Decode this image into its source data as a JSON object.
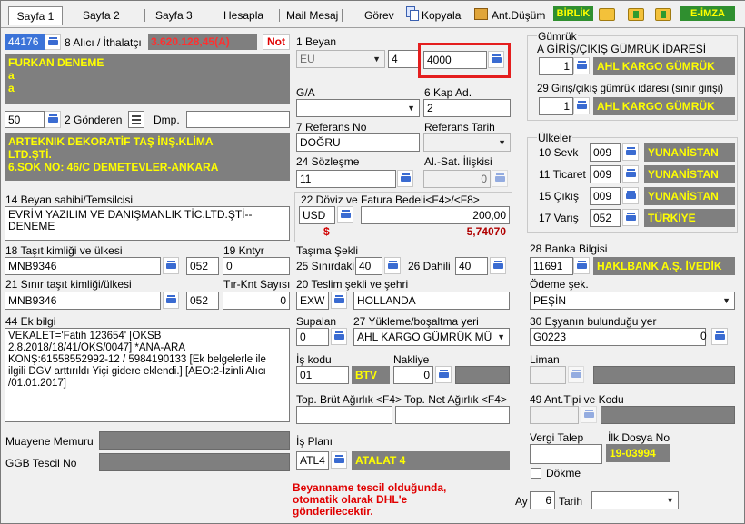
{
  "tabs": [
    "Sayfa 1",
    "Sayfa 2",
    "Sayfa 3",
    "Hesapla",
    "Mail Mesaj",
    "Görev",
    "Kopyala",
    "Ant.Düşüm"
  ],
  "toolbar": {
    "birlik": "BİRLİK",
    "eimza": "E-İMZA"
  },
  "top": {
    "id": "44176",
    "alici_label": "8 Alıcı / İthalatçı",
    "amount": "3.620.128,45(A)",
    "not": "Not"
  },
  "alici": {
    "lines": [
      "FURKAN DENEME",
      "a",
      "a"
    ]
  },
  "gonderen": {
    "num": "50",
    "label": "2 Gönderen",
    "dmp": "Dmp.",
    "lines": [
      "ARTEKNIK DEKORATİF TAŞ İNŞ.KLİMA",
      "LTD.ŞTİ.",
      "6.SOK NO: 46/C DEMETEVLER-ANKARA"
    ]
  },
  "beyan": {
    "label": "1 Beyan",
    "c1": "EU",
    "c2": "4",
    "c3": "4000"
  },
  "ga": {
    "label": "G/A",
    "value": ""
  },
  "kap": {
    "label": "6 Kap Ad.",
    "value": "2"
  },
  "ref": {
    "label": "7 Referans No",
    "value": "DOĞRU",
    "tarih_label": "Referans Tarih"
  },
  "soz": {
    "label": "24 Sözleşme",
    "value": "11",
    "al_label": "Al.-Sat. İlişkisi",
    "al_value": "0"
  },
  "doviz": {
    "label": "22 Döviz ve Fatura Bedeli<F4>/<F8>",
    "cur": "USD",
    "amount": "200,00",
    "dollar": "$",
    "rate": "5,74070"
  },
  "beyan_sahibi": {
    "label": "14 Beyan sahibi/Temsilcisi",
    "lines": [
      "EVRİM YAZILIM VE DANIŞMANLIK TİC.LTD.ŞTİ--",
      "DENEME"
    ]
  },
  "tasit": {
    "label": "18 Taşıt kimliği ve ülkesi",
    "value": "MNB9346",
    "code": "052",
    "kntyr_label": "19 Kntyr",
    "kntyr": "0"
  },
  "sinir": {
    "label": "21 Sınır taşıt kimliği/ülkesi",
    "value": "MNB9346",
    "code": "052",
    "tir_label": "Tır-Knt Sayısı",
    "tir": "0"
  },
  "tasima": {
    "label": "Taşıma Şekli",
    "l25": "25 Sınırdaki",
    "v25": "40",
    "l26": "26 Dahili",
    "v26": "40"
  },
  "teslim": {
    "label": "20 Teslim şekli ve şehri",
    "code": "EXW",
    "city": "HOLLANDA"
  },
  "ek": {
    "label": "44 Ek bilgi",
    "lines": [
      "VEKALET='Fatih 123654' [OKSB",
      "2.8.2018/18/41/OKS/0047] *ANA-ARA",
      "KONŞ:61558552992-12 / 5984190133 [Ek belgelerle ile",
      "ilgili DGV arttırıldı Yiçi gidere eklendi.] [AEO:2-İzinli Alıcı",
      "/01.01.2017]"
    ]
  },
  "supalan": {
    "label": "Supalan",
    "value": "0"
  },
  "yukleme": {
    "label": "27 Yükleme/boşaltma yeri",
    "value": "AHL KARGO GÜMRÜK MÜ"
  },
  "iskodu": {
    "label": "İş kodu",
    "value": "01",
    "btv": "BTV",
    "nak_label": "Nakliye",
    "nak": "0"
  },
  "agirlik": {
    "label": "Top. Brüt Ağırlık <F4> Top. Net Ağırlık <F4>"
  },
  "isplani": {
    "label": "İş Planı",
    "value": "ATL4",
    "name": "ATALAT 4"
  },
  "muayene": {
    "label": "Muayene Memuru"
  },
  "ggb": {
    "label": "GGB Tescil No"
  },
  "red": {
    "lines": [
      "Beyanname tescil olduğunda,",
      "otomatik olarak DHL'e",
      "gönderilecektir."
    ]
  },
  "gumruk": {
    "group": "Gümrük",
    "label1": "A GİRİŞ/ÇIKIŞ GÜMRÜK İDARESİ",
    "v1": "1",
    "n1": "AHL KARGO GÜMRÜK",
    "label2": "29 Giriş/çıkış gümrük idaresi (sınır girişi)",
    "v2": "1",
    "n2": "AHL KARGO GÜMRÜK"
  },
  "ulkeler": {
    "group": "Ülkeler",
    "rows": [
      {
        "label": "10 Sevk",
        "code": "009",
        "name": "YUNANİSTAN"
      },
      {
        "label": "11 Ticaret",
        "code": "009",
        "name": "YUNANİSTAN"
      },
      {
        "label": "15 Çıkış",
        "code": "009",
        "name": "YUNANİSTAN"
      },
      {
        "label": "17 Varış",
        "code": "052",
        "name": "TÜRKİYE"
      }
    ]
  },
  "banka": {
    "label": "28 Banka Bilgisi",
    "code": "11691",
    "name": "HAKLBANK A.Ş. İVEDİK"
  },
  "odeme": {
    "label": "Ödeme şek.",
    "value": "PEŞİN"
  },
  "esya": {
    "label": "30 Eşyanın bulunduğu yer",
    "code": "G0223",
    "v": "0"
  },
  "liman": {
    "label": "Liman"
  },
  "ant": {
    "label": "49 Ant.Tipi ve Kodu"
  },
  "vergi": {
    "label": "Vergi Talep",
    "dosya_label": "İlk Dosya No",
    "dosya": "19-03994",
    "dokme": "Dökme"
  },
  "ay": {
    "label": "Ay",
    "value": "6",
    "tarih": "Tarih"
  }
}
